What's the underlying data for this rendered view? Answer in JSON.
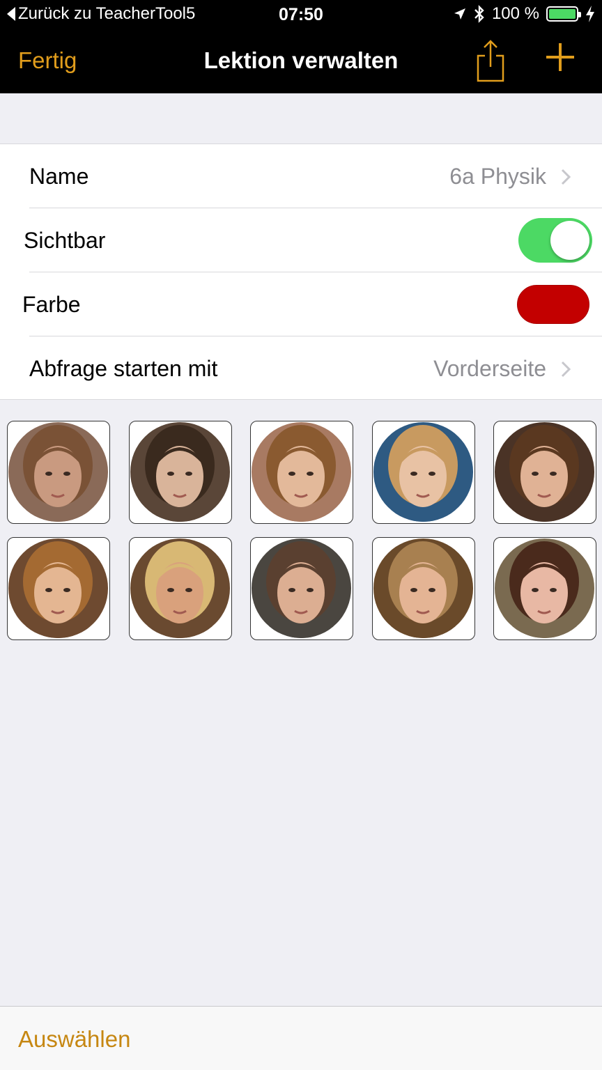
{
  "status_bar": {
    "back_label": "Zurück zu TeacherTool5",
    "time": "07:50",
    "battery_text": "100 %",
    "icons": [
      "location-arrow-icon",
      "bluetooth-icon",
      "battery-icon",
      "charging-bolt-icon"
    ]
  },
  "nav": {
    "done_label": "Fertig",
    "title": "Lektion verwalten",
    "accent_color": "#e19d1c"
  },
  "settings": {
    "name_label": "Name",
    "name_value": "6a Physik",
    "visible_label": "Sichtbar",
    "visible_on": true,
    "color_label": "Farbe",
    "color_value": "#c30000",
    "query_label": "Abfrage starten mit",
    "query_value": "Vorderseite"
  },
  "students": {
    "rows": 2,
    "per_row": 5,
    "photos": [
      {
        "hair": "#7a5236",
        "skin": "#c99a80",
        "bg": "#8a6a58"
      },
      {
        "hair": "#3a2a1e",
        "skin": "#d9b49a",
        "bg": "#5a4638"
      },
      {
        "hair": "#8a5a30",
        "skin": "#e3b99a",
        "bg": "#a87a62"
      },
      {
        "hair": "#c89a60",
        "skin": "#e8c2a4",
        "bg": "#2e5a82"
      },
      {
        "hair": "#5a3820",
        "skin": "#e0b295",
        "bg": "#4a3326"
      },
      {
        "hair": "#a46a32",
        "skin": "#e4b692",
        "bg": "#6e4a30"
      },
      {
        "hair": "#d8b874",
        "skin": "#d9a17c",
        "bg": "#6a4a30"
      },
      {
        "hair": "#5a4030",
        "skin": "#dcae92",
        "bg": "#4a4640"
      },
      {
        "hair": "#a88050",
        "skin": "#e4b494",
        "bg": "#6a4a2a"
      },
      {
        "hair": "#4a2a1c",
        "skin": "#e8b8a4",
        "bg": "#7a6a50"
      }
    ]
  },
  "toolbar": {
    "select_label": "Auswählen"
  }
}
